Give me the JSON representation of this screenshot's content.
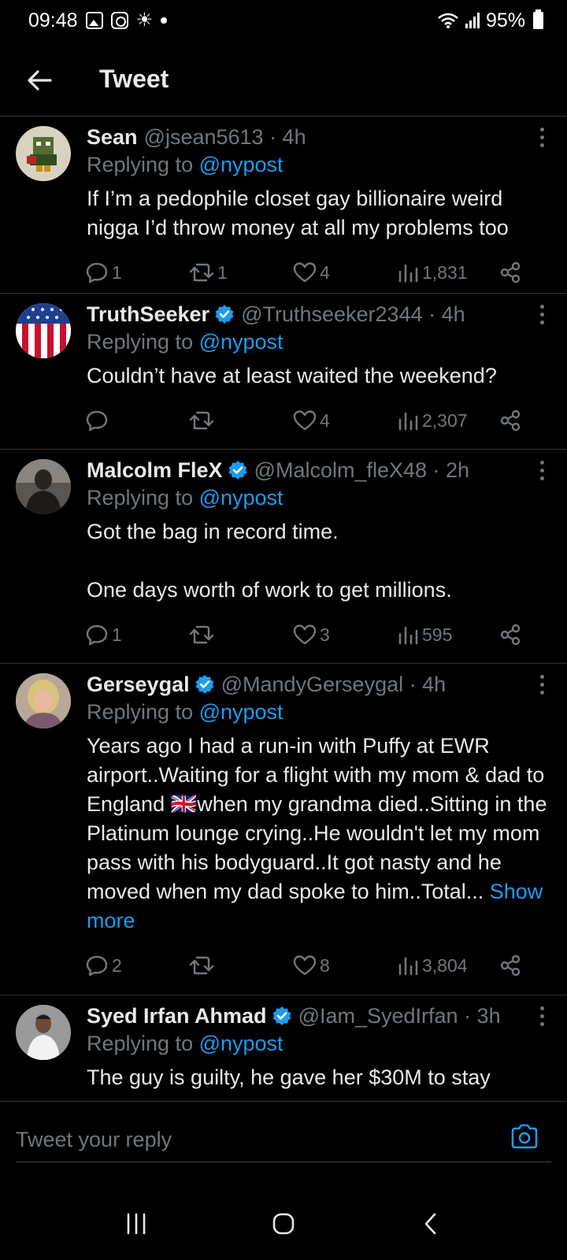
{
  "status_bar": {
    "time": "09:48",
    "battery": "95%",
    "icons": [
      "gallery-icon",
      "instagram-icon",
      "brightness-icon",
      "dot-icon",
      "wifi-icon",
      "signal-icon",
      "battery-icon"
    ]
  },
  "header": {
    "title": "Tweet",
    "back_icon": "arrow-left-icon"
  },
  "tweets": [
    {
      "name": "Sean",
      "verified": false,
      "handle": "@jsean5613 · 4h",
      "replying_prefix": "Replying to ",
      "replying_to": "@nypost",
      "text": "If I’m a pedophile closet gay billionaire weird nigga I’d throw money at all my problems too",
      "replies": "1",
      "retweets": "1",
      "likes": "4",
      "views": "1,831"
    },
    {
      "name": "TruthSeeker",
      "verified": true,
      "handle": "@Truthseeker2344 · 4h",
      "replying_prefix": "Replying to ",
      "replying_to": "@nypost",
      "text": "Couldn’t have at least waited the weekend?",
      "replies": "",
      "retweets": "",
      "likes": "4",
      "views": "2,307"
    },
    {
      "name": "Malcolm FleX",
      "verified": true,
      "handle": "@Malcolm_fleX48 · 2h",
      "replying_prefix": "Replying to ",
      "replying_to": "@nypost",
      "text": "Got the bag in record time.\n\nOne days worth of work to get millions.",
      "replies": "1",
      "retweets": "",
      "likes": "3",
      "views": "595"
    },
    {
      "name": "Gerseygal",
      "verified": true,
      "handle": "@MandyGerseygal · 4h",
      "replying_prefix": "Replying to ",
      "replying_to": "@nypost",
      "text": "Years ago I had a run-in with Puffy at EWR airport..Waiting for a flight with my mom & dad to England 🇬🇧when my grandma died..Sitting in the Platinum lounge crying..He wouldn't let my mom pass with his bodyguard..It got nasty and he moved when my dad spoke to him..Total... ",
      "show_more": "Show more",
      "replies": "2",
      "retweets": "",
      "likes": "8",
      "views": "3,804"
    },
    {
      "name": "Syed Irfan Ahmad",
      "verified": true,
      "handle": "@Iam_SyedIrfan · 3h",
      "replying_prefix": "Replying to ",
      "replying_to": "@nypost",
      "text": "The guy is guilty, he gave her $30M to stay"
    }
  ],
  "reply_bar": {
    "placeholder": "Tweet your reply",
    "camera_icon": "camera-icon"
  },
  "nav_bar": {
    "icons": [
      "recent-apps-icon",
      "home-icon",
      "back-icon"
    ]
  },
  "colors": {
    "background": "#000000",
    "text": "#e7e9ea",
    "muted": "#71767b",
    "accent": "#1d9bf0",
    "divider": "#2f3336"
  }
}
